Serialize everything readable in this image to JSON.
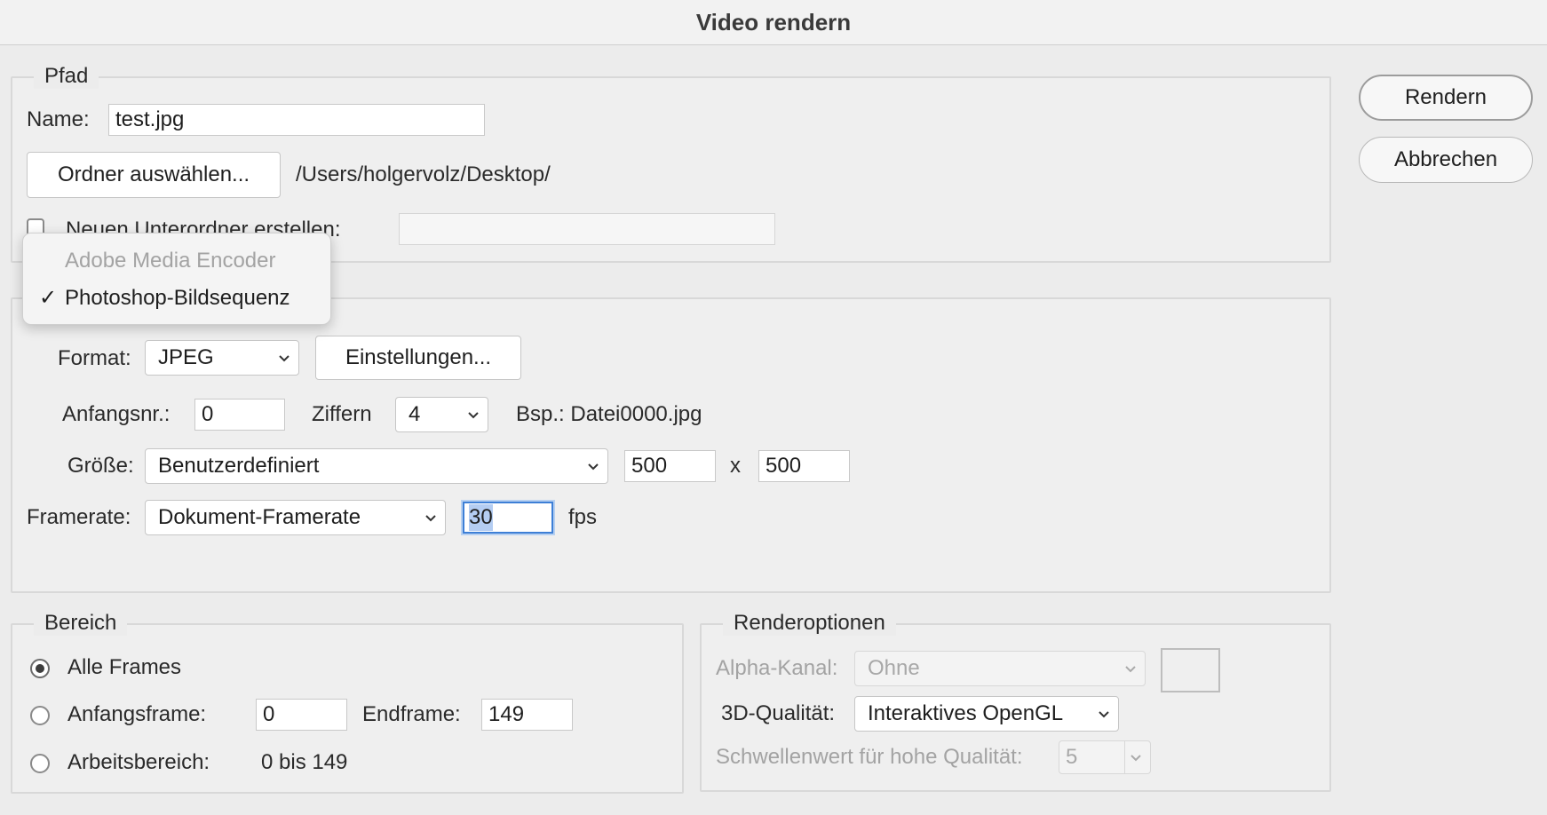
{
  "window": {
    "title": "Video rendern"
  },
  "buttons": {
    "render": "Rendern",
    "cancel": "Abbrechen"
  },
  "path_group": {
    "legend": "Pfad",
    "name_label": "Name:",
    "name_value": "test.jpg",
    "choose_folder": "Ordner auswählen...",
    "folder_path": "/Users/holgervolz/Desktop/",
    "subfolder_label": "Neuen Unterordner erstellen:",
    "subfolder_checked": false,
    "subfolder_value": ""
  },
  "encoder_menu": {
    "items": [
      {
        "label": "Adobe Media Encoder",
        "enabled": false,
        "checked": false
      },
      {
        "label": "Photoshop-Bildsequenz",
        "enabled": true,
        "checked": true
      }
    ],
    "check_glyph": "✓"
  },
  "format_group": {
    "format_label": "Format:",
    "format_value": "JPEG",
    "settings_button": "Einstellungen...",
    "start_label": "Anfangsnr.:",
    "start_value": "0",
    "digits_label": "Ziffern",
    "digits_value": "4",
    "example": "Bsp.: Datei0000.jpg",
    "size_label": "Größe:",
    "size_value": "Benutzerdefiniert",
    "width_value": "500",
    "by": "x",
    "height_value": "500",
    "framerate_label": "Framerate:",
    "framerate_value": "Dokument-Framerate",
    "fps_value": "30",
    "fps_unit": "fps"
  },
  "range_group": {
    "legend": "Bereich",
    "all_frames": "Alle Frames",
    "start_frame_label": "Anfangsframe:",
    "start_frame_value": "0",
    "end_frame_label": "Endframe:",
    "end_frame_value": "149",
    "work_area_label": "Arbeitsbereich:",
    "work_area_value": "0 bis 149",
    "selected": "Alle Frames"
  },
  "render_options": {
    "legend": "Renderoptionen",
    "alpha_label": "Alpha-Kanal:",
    "alpha_value": "Ohne",
    "quality_label": "3D-Qualität:",
    "quality_value": "Interaktives OpenGL",
    "threshold_label": "Schwellenwert für hohe Qualität:",
    "threshold_value": "5"
  },
  "colors": {
    "focus": "#3d7fd6",
    "selection": "#b4cdf2",
    "disabled_text": "#a3a3a3"
  }
}
